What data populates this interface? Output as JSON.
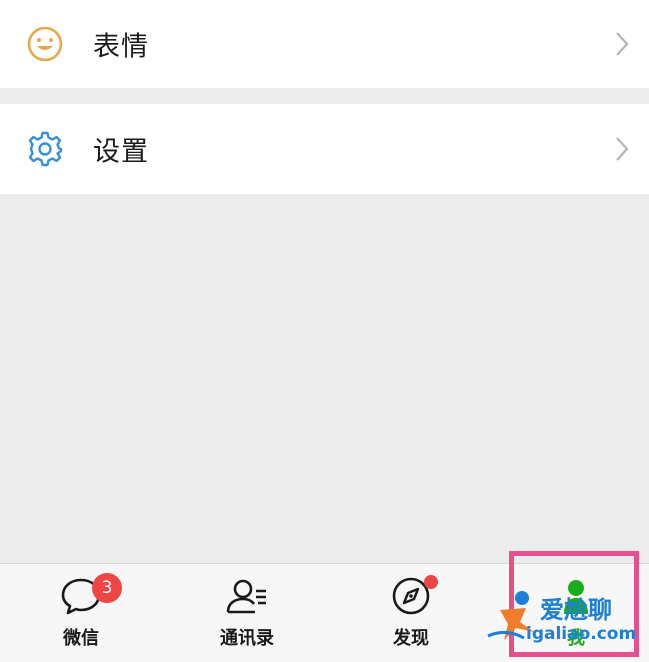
{
  "menu": {
    "items": [
      {
        "label": "表情",
        "icon": "smiley-icon"
      },
      {
        "label": "设置",
        "icon": "gear-icon"
      }
    ]
  },
  "tabbar": {
    "tabs": [
      {
        "label": "微信",
        "icon": "chat-bubble-icon",
        "badge": "3"
      },
      {
        "label": "通讯录",
        "icon": "contacts-icon"
      },
      {
        "label": "发现",
        "icon": "compass-icon",
        "dot": true
      },
      {
        "label": "我",
        "icon": "person-icon"
      }
    ]
  },
  "watermark": {
    "title": "爱尬聊",
    "url": "igaliao.com"
  },
  "colors": {
    "background": "#ececec",
    "badge": "#f04545",
    "highlight": "#e84f8e",
    "smiley": "#e5a84a",
    "gear": "#3a8fd8",
    "watermark": "#1e7fd6"
  }
}
